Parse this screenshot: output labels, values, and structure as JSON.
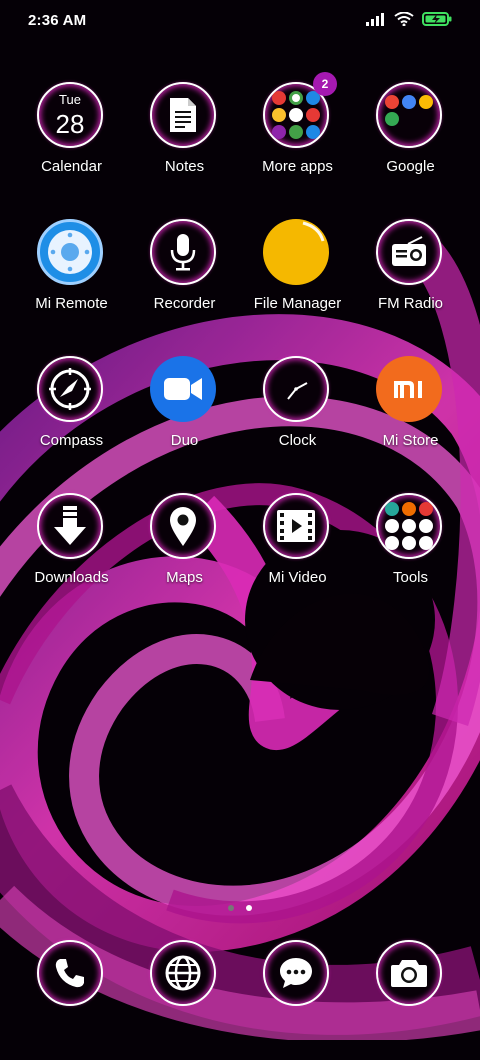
{
  "status_bar": {
    "time": "2:36 AM"
  },
  "apps": [
    {
      "label": "Calendar",
      "icon": "calendar-icon",
      "day": "Tue",
      "date": "28"
    },
    {
      "label": "Notes",
      "icon": "notes-icon"
    },
    {
      "label": "More apps",
      "icon": "folder-icon",
      "badge": "2"
    },
    {
      "label": "Google",
      "icon": "folder-icon"
    },
    {
      "label": "Mi Remote",
      "icon": "remote-icon"
    },
    {
      "label": "Recorder",
      "icon": "microphone-icon"
    },
    {
      "label": "File Manager",
      "icon": "folder-file-icon"
    },
    {
      "label": "FM Radio",
      "icon": "radio-icon"
    },
    {
      "label": "Compass",
      "icon": "compass-icon"
    },
    {
      "label": "Duo",
      "icon": "video-camera-icon"
    },
    {
      "label": "Clock",
      "icon": "clock-icon"
    },
    {
      "label": "Mi Store",
      "icon": "mi-logo-icon",
      "logo_text": "mi"
    },
    {
      "label": "Downloads",
      "icon": "download-icon"
    },
    {
      "label": "Maps",
      "icon": "map-pin-icon"
    },
    {
      "label": "Mi Video",
      "icon": "film-icon"
    },
    {
      "label": "Tools",
      "icon": "folder-icon"
    }
  ],
  "dock": [
    {
      "name": "phone",
      "icon": "phone-icon"
    },
    {
      "name": "browser",
      "icon": "globe-icon"
    },
    {
      "name": "messages",
      "icon": "chat-icon"
    },
    {
      "name": "camera",
      "icon": "camera-icon"
    }
  ],
  "page_indicator": {
    "pages": 2,
    "current": 2
  },
  "colors": {
    "accent": "#e028c8",
    "badge": "#a519b0",
    "file_manager": "#f5b800",
    "mi_store": "#f26b1d",
    "duo": "#1a73e8",
    "mi_remote": "#1e8ee6"
  }
}
